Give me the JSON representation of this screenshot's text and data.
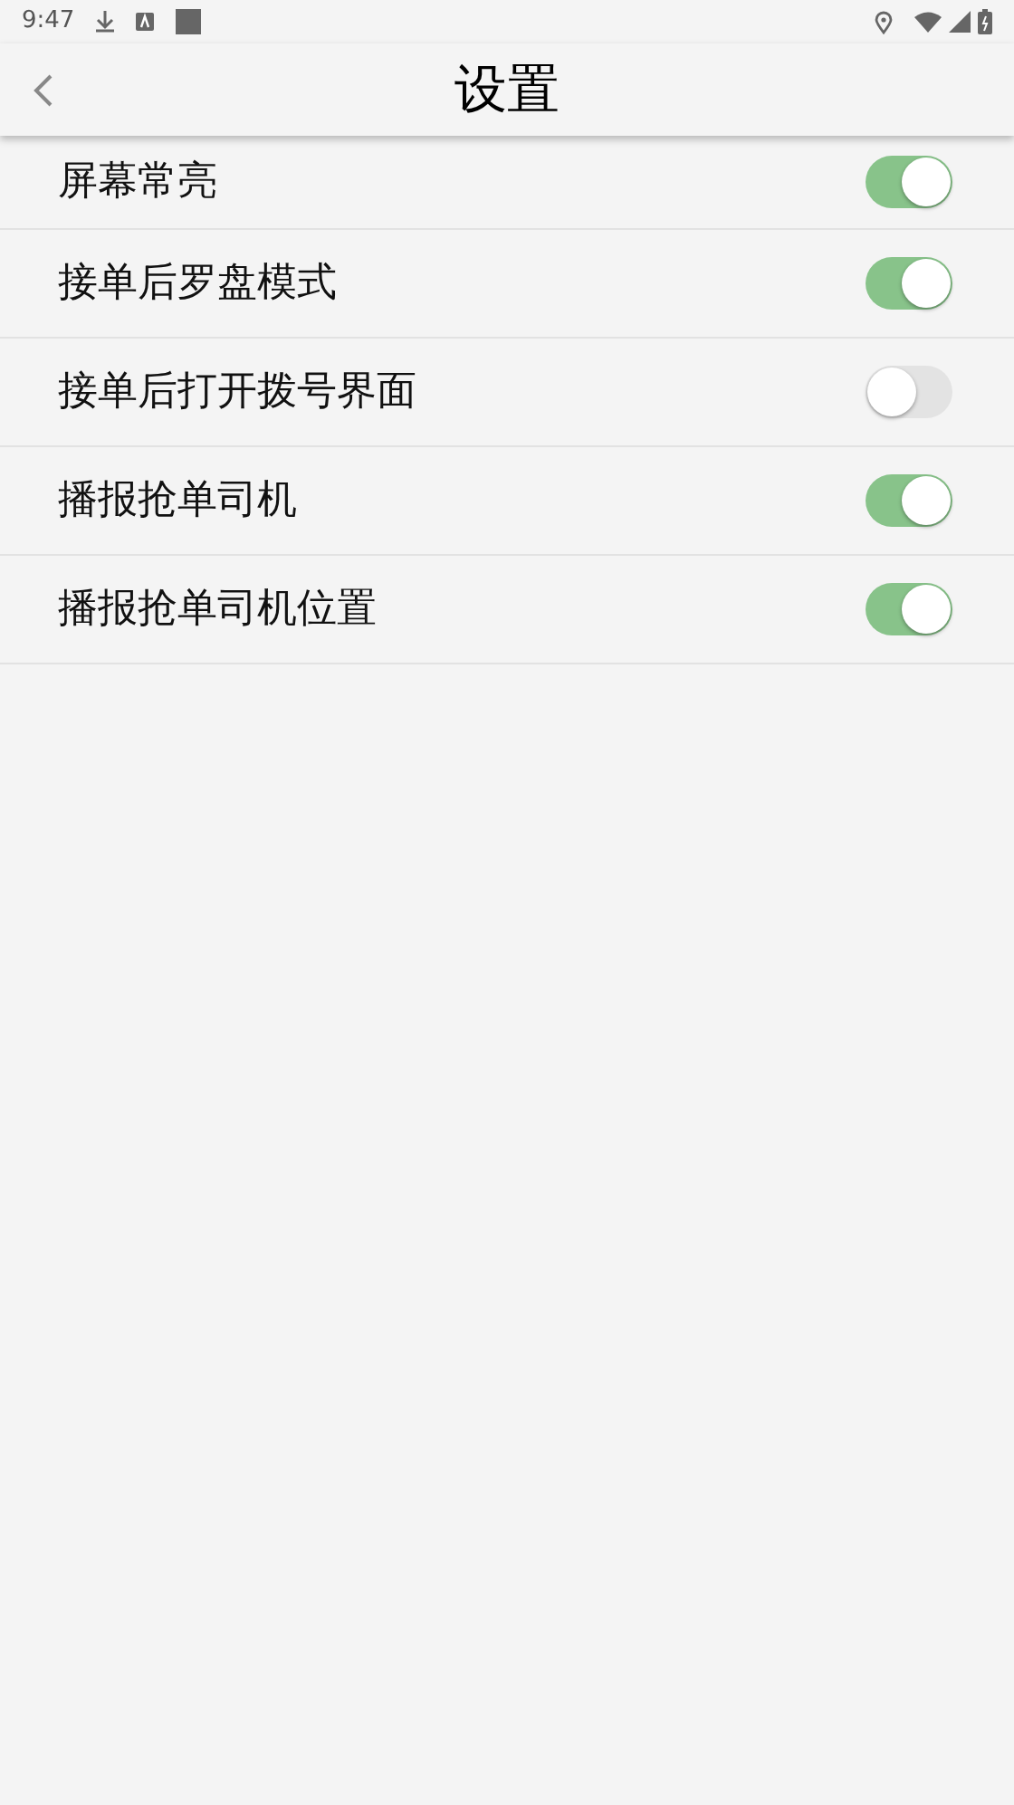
{
  "status_bar": {
    "time": "9:47"
  },
  "header": {
    "title": "设置"
  },
  "settings": [
    {
      "label": "屏幕常亮",
      "on": true
    },
    {
      "label": "接单后罗盘模式",
      "on": true
    },
    {
      "label": "接单后打开拨号界面",
      "on": false
    },
    {
      "label": "播报抢单司机",
      "on": true
    },
    {
      "label": "播报抢单司机位置",
      "on": true
    }
  ]
}
